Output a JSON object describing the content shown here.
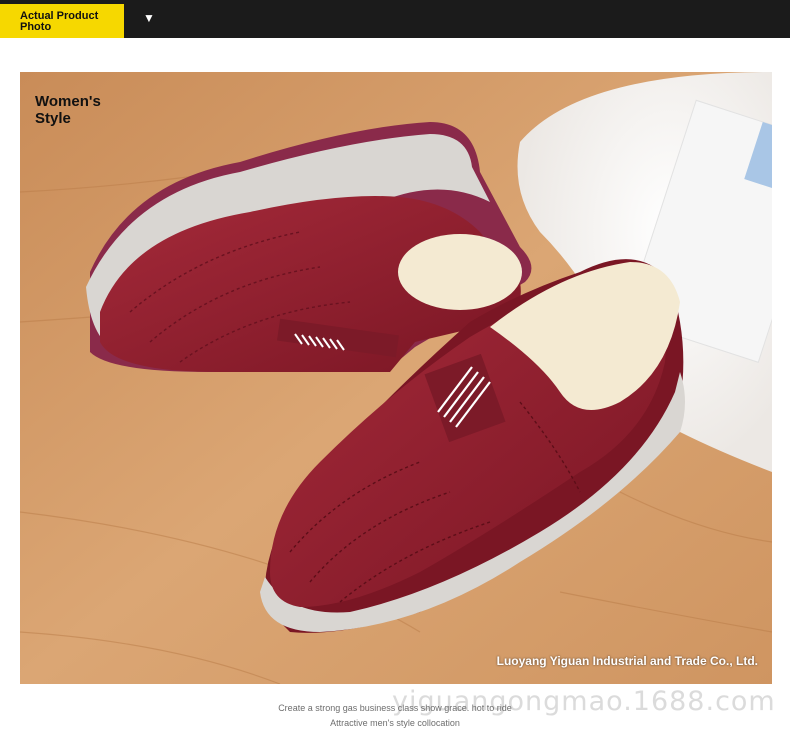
{
  "header": {
    "tag_label": "Actual Product\nPhoto",
    "arrow_glyph": "▼"
  },
  "photo": {
    "style_label": "Women's\nStyle",
    "company": "Luoyang Yiguan Industrial and Trade Co., Ltd.",
    "shoe_color": "#8d1e2c",
    "sole_color": "#d9d6d2",
    "lining_color": "#f4ead2"
  },
  "captions": {
    "line1": "Create a strong gas business class show grace. hot to ride",
    "line2": "Attractive men's style collocation"
  },
  "watermark": "yiguangongmao.1688.com"
}
